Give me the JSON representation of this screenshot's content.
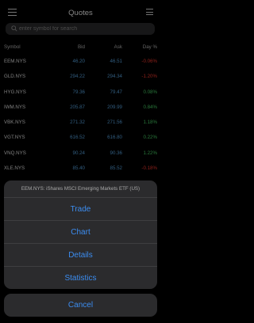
{
  "header": {
    "title": "Quotes",
    "menu_icon": "menu-icon",
    "edit_icon": "list-icon"
  },
  "search": {
    "placeholder": "enter symbol for search",
    "value": ""
  },
  "table": {
    "columns": {
      "symbol": "Symbol",
      "bid": "Bid",
      "ask": "Ask",
      "day": "Day %"
    },
    "rows": [
      {
        "symbol": "EEM.NYS",
        "bid": "46.20",
        "ask": "46.51",
        "day": "-0.06%",
        "trend": "neg"
      },
      {
        "symbol": "GLD.NYS",
        "bid": "294.22",
        "ask": "294.34",
        "day": "-1.20%",
        "trend": "neg"
      },
      {
        "symbol": "HYG.NYS",
        "bid": "79.36",
        "ask": "79.47",
        "day": "0.08%",
        "trend": "pos"
      },
      {
        "symbol": "IWM.NYS",
        "bid": "205.87",
        "ask": "209.99",
        "day": "0.84%",
        "trend": "pos"
      },
      {
        "symbol": "VBK.NYS",
        "bid": "271.32",
        "ask": "271.56",
        "day": "1.18%",
        "trend": "pos"
      },
      {
        "symbol": "VGT.NYS",
        "bid": "616.52",
        "ask": "616.80",
        "day": "0.22%",
        "trend": "pos"
      },
      {
        "symbol": "VNQ.NYS",
        "bid": "90.24",
        "ask": "90.36",
        "day": "1.22%",
        "trend": "pos"
      },
      {
        "symbol": "XLE.NYS",
        "bid": "85.40",
        "ask": "85.52",
        "day": "-0.18%",
        "trend": "neg"
      }
    ]
  },
  "action_sheet": {
    "title": "EEM.NYS: iShares MSCI Emerging Markets ETF (US)",
    "actions": [
      "Trade",
      "Chart",
      "Details",
      "Statistics"
    ],
    "cancel": "Cancel"
  },
  "colors": {
    "accent": "#3c8df0",
    "positive": "#4bd76a",
    "negative": "#ff3b30",
    "price": "#5aa8e6"
  }
}
